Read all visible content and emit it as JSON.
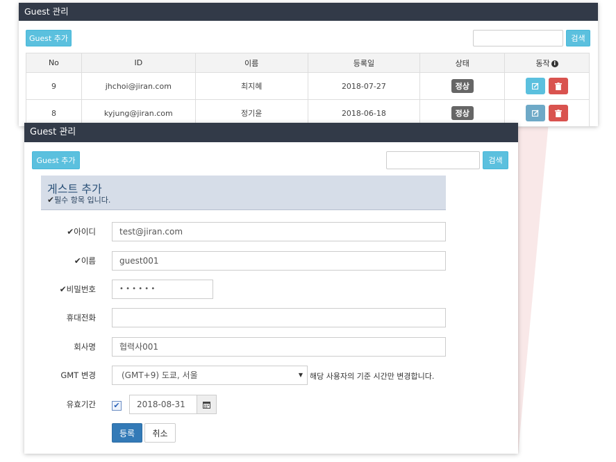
{
  "background_panel": {
    "title": "Guest 관리",
    "add_button_label": "Guest 추가",
    "search_placeholder": "",
    "search_button_label": "검색",
    "table": {
      "headers": {
        "no": "No",
        "id": "ID",
        "name": "이름",
        "date": "등록일",
        "status": "상태",
        "action": "동작"
      },
      "rows": [
        {
          "no": "9",
          "id": "jhchoi@jiran.com",
          "name": "최지혜",
          "date": "2018-07-27",
          "status": "정상"
        },
        {
          "no": "8",
          "id": "kyjung@jiran.com",
          "name": "정기윤",
          "date": "2018-06-18",
          "status": "정상"
        }
      ]
    }
  },
  "front_panel": {
    "title": "Guest 관리",
    "add_button_label": "Guest 추가",
    "search_placeholder": "",
    "search_button_label": "검색",
    "form": {
      "title": "게스트 추가",
      "required_note": "필수 항목 입니다.",
      "id_label": "아이디",
      "id_value": "test@jiran.com",
      "name_label": "이름",
      "name_value": "guest001",
      "password_label": "비밀번호",
      "password_value": "• • • • • •",
      "phone_label": "휴대전화",
      "phone_value": "",
      "company_label": "회사명",
      "company_value": "협력사001",
      "gmt_label": "GMT 변경",
      "gmt_value": "(GMT+9) 도쿄, 서울",
      "gmt_hint": "해당 사용자의 기준 시간만 변경합니다.",
      "expiry_label": "유효기간",
      "expiry_checked": true,
      "expiry_value": "2018-08-31",
      "submit_label": "등록",
      "cancel_label": "취소"
    }
  },
  "colors": {
    "header_bg": "#323a48",
    "info_button": "#5bc0de",
    "primary_button": "#337ab7",
    "danger_button": "#d9534f",
    "status_badge": "#666666",
    "form_title_bg": "#d6dde8"
  },
  "icons": {
    "check": "checkmark-icon",
    "edit": "edit-icon",
    "delete": "trash-icon",
    "info": "info-circle-icon",
    "calendar": "calendar-icon",
    "select": "caret-down-icon"
  }
}
